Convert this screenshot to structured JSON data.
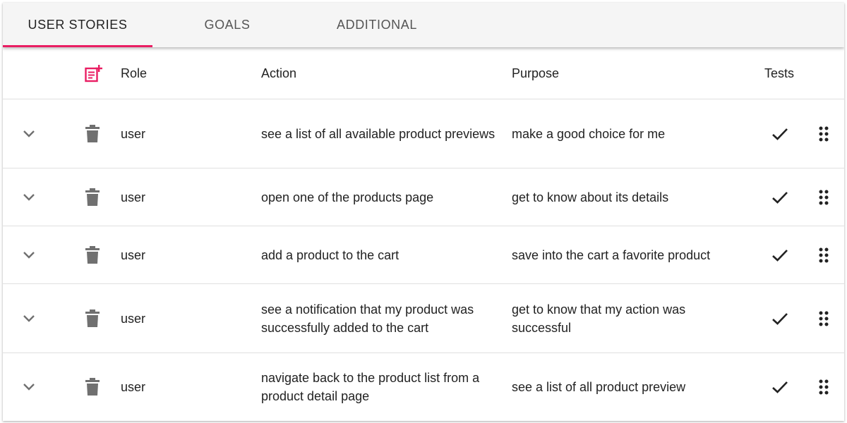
{
  "tabs": [
    {
      "label": "USER STORIES",
      "active": true
    },
    {
      "label": "GOALS",
      "active": false
    },
    {
      "label": "ADDITIONAL",
      "active": false
    }
  ],
  "colors": {
    "accent": "#e91e63",
    "icon_gray": "#707070",
    "text": "#222222"
  },
  "table": {
    "add_icon": "note-add-icon",
    "columns": {
      "role": "Role",
      "action": "Action",
      "purpose": "Purpose",
      "tests": "Tests"
    },
    "rows": [
      {
        "role": "user",
        "action": "see a list of all available product previews",
        "purpose": "make a good choice for me",
        "tests": true
      },
      {
        "role": "user",
        "action": "open one of the products page",
        "purpose": "get to know about its details",
        "tests": true
      },
      {
        "role": "user",
        "action": "add a product to the cart",
        "purpose": "save into the cart a favorite product",
        "tests": true
      },
      {
        "role": "user",
        "action": "see a notification that my product was successfully added to the cart",
        "purpose": "get to know that my action was successful",
        "tests": true
      },
      {
        "role": "user",
        "action": "navigate back to the product list from a product detail page",
        "purpose": "see a list of all product preview",
        "tests": true
      }
    ]
  }
}
